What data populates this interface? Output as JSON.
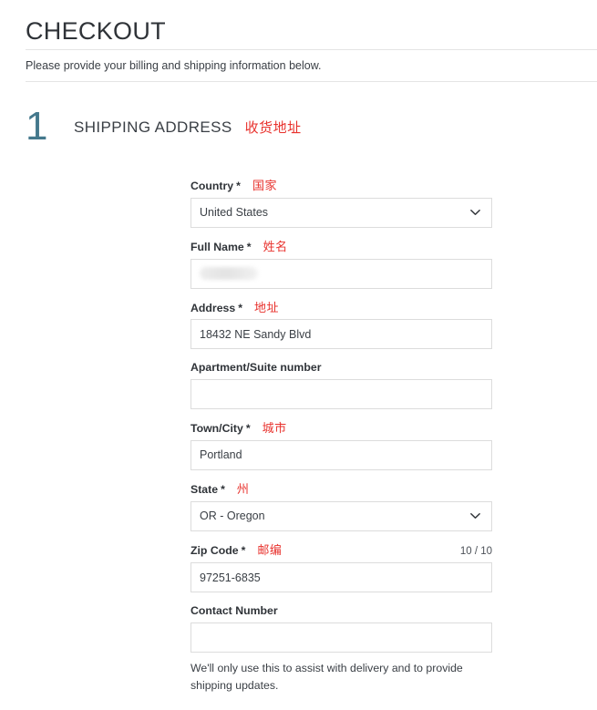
{
  "header": {
    "title": "CHECKOUT",
    "intro": "Please provide your billing and shipping information below."
  },
  "step": {
    "number": "1",
    "title": "SHIPPING ADDRESS",
    "title_cn": "收货地址",
    "number_color": "#44788c",
    "annotation_color": "#e8312c"
  },
  "form": {
    "fields": [
      {
        "label": "Country",
        "required_mark": "*",
        "label_cn": "国家",
        "value": "United States",
        "type": "select",
        "icon": "chevron-down-icon"
      },
      {
        "label": "Full Name",
        "required_mark": "*",
        "label_cn": "姓名",
        "value": "",
        "type": "text-redacted"
      },
      {
        "label": "Address",
        "required_mark": "*",
        "label_cn": "地址",
        "value": "18432 NE Sandy Blvd",
        "type": "text"
      },
      {
        "label": "Apartment/Suite number",
        "required_mark": "",
        "label_cn": "",
        "value": "",
        "type": "text"
      },
      {
        "label": "Town/City",
        "required_mark": "*",
        "label_cn": "城市",
        "value": "Portland",
        "type": "text"
      },
      {
        "label": "State",
        "required_mark": "*",
        "label_cn": "州",
        "value": "OR - Oregon",
        "type": "select",
        "icon": "chevron-down-icon"
      },
      {
        "label": "Zip Code",
        "required_mark": "*",
        "label_cn": "邮编",
        "value": "97251-6835",
        "type": "text",
        "counter": "10 / 10"
      },
      {
        "label": "Contact Number",
        "required_mark": "",
        "label_cn": "",
        "value": "",
        "type": "text",
        "helper": "We'll only use this to assist with delivery and to provide shipping updates."
      }
    ]
  }
}
